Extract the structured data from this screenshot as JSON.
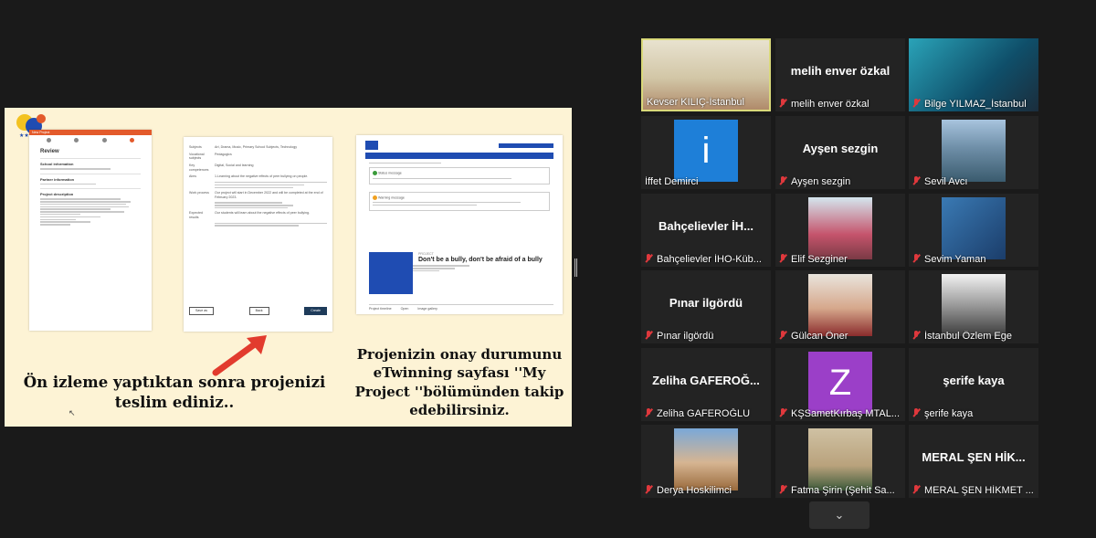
{
  "slide": {
    "caption_left": "Ön izleme yaptıktan sonra projenizi teslim ediniz..",
    "caption_right": "Projenizin onay durumunu eTwinning sayfası ''My Project ''bölümünden takip edebilirsiniz.",
    "review_panel": {
      "header": "New Project",
      "title": "Review",
      "sections": [
        "School information",
        "Partner information",
        "Project description"
      ],
      "edit_label": "Modify"
    },
    "details_panel": {
      "rows": [
        {
          "k": "Subjects",
          "v": "Art, Drama, Music, Primary School Subjects, Technology"
        },
        {
          "k": "Vocational subjects",
          "v": "Pedagogics"
        },
        {
          "k": "Key competences",
          "v": "Digital, Social and learning"
        },
        {
          "k": "Aims",
          "v": "1.Learning about the negative effects of peer bullying on people."
        },
        {
          "k": "Work process",
          "v": "Our project will start in December 2022 and will be completed at the end of February 2023."
        },
        {
          "k": "Expected results",
          "v": "Our students will learn about the negative effects of peer bullying."
        }
      ],
      "buttons": [
        "Save as",
        "Back",
        "Create"
      ]
    },
    "portal_panel": {
      "notice_ok": "Status message",
      "notice_warn": "Warning message",
      "project_tag": "PROJECT",
      "project_title": "Don't be a bully, don't be afraid of a bully",
      "tabs": [
        "Project timeline",
        "Open",
        "Image gallery"
      ]
    }
  },
  "participants": [
    {
      "label": "Kevser KILIÇ-İstanbul",
      "muted": false,
      "active": true,
      "kind": "video",
      "bigname": ""
    },
    {
      "label": "melih enver özkal",
      "muted": true,
      "active": false,
      "kind": "name",
      "bigname": "melih enver özkal"
    },
    {
      "label": "Bilge YILMAZ_İstanbul",
      "muted": true,
      "active": false,
      "kind": "video",
      "bigname": ""
    },
    {
      "label": "İffet Demirci",
      "muted": false,
      "active": false,
      "kind": "avatar-i",
      "bigname": ""
    },
    {
      "label": "Ayşen sezgin",
      "muted": true,
      "active": false,
      "kind": "name",
      "bigname": "Ayşen sezgin"
    },
    {
      "label": "Sevil Avcı",
      "muted": true,
      "active": false,
      "kind": "video",
      "bigname": ""
    },
    {
      "label": "Bahçelievler İHO-Küb...",
      "muted": true,
      "active": false,
      "kind": "name",
      "bigname": "Bahçelievler İH..."
    },
    {
      "label": "Elif Sezginer",
      "muted": true,
      "active": false,
      "kind": "video",
      "bigname": ""
    },
    {
      "label": "Sevim Yaman",
      "muted": true,
      "active": false,
      "kind": "video",
      "bigname": ""
    },
    {
      "label": "Pınar ilgördü",
      "muted": true,
      "active": false,
      "kind": "name",
      "bigname": "Pınar ilgördü"
    },
    {
      "label": "Gülcan Öner",
      "muted": true,
      "active": false,
      "kind": "video",
      "bigname": ""
    },
    {
      "label": "İstanbul Özlem Ege",
      "muted": true,
      "active": false,
      "kind": "video",
      "bigname": ""
    },
    {
      "label": "Zeliha GAFEROĞLU",
      "muted": true,
      "active": false,
      "kind": "name",
      "bigname": "Zeliha GAFEROĞ..."
    },
    {
      "label": "KŞSametKırbaş MTAL...",
      "muted": true,
      "active": false,
      "kind": "avatar-z",
      "bigname": ""
    },
    {
      "label": "şerife kaya",
      "muted": true,
      "active": false,
      "kind": "name",
      "bigname": "şerife kaya"
    },
    {
      "label": "Derya Hoskilimci",
      "muted": true,
      "active": false,
      "kind": "video",
      "bigname": ""
    },
    {
      "label": "Fatma Şirin (Şehit Sa...",
      "muted": true,
      "active": false,
      "kind": "video",
      "bigname": ""
    },
    {
      "label": "MERAL ŞEN HİKMET ...",
      "muted": true,
      "active": false,
      "kind": "name",
      "bigname": "MERAL ŞEN HİK..."
    }
  ],
  "avatar_letters": {
    "i": "i",
    "z": "Z"
  },
  "colors": {
    "accent_active": "#d9d97a",
    "mic_muted": "#e0383c",
    "slide_bg": "#fdf3d5"
  },
  "icons": [
    "mic-muted-icon",
    "chevron-down-icon",
    "etwinning-logo"
  ]
}
